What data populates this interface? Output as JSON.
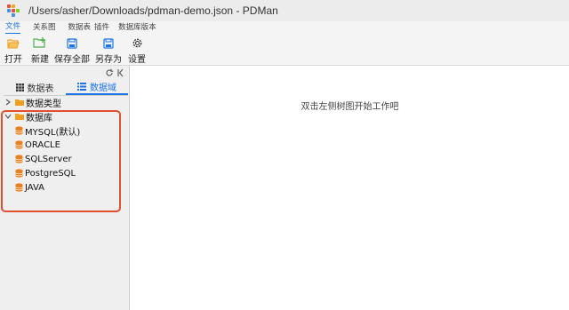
{
  "window": {
    "title": "/Users/asher/Downloads/pdman-demo.json - PDMan"
  },
  "menu": [
    "文件",
    "关系图",
    "数据表",
    "插件",
    "数据库版本"
  ],
  "toolbar": {
    "open": {
      "label": "打开",
      "icon": "folder-open-icon"
    },
    "new": {
      "label": "新建",
      "icon": "folder-plus-icon"
    },
    "save_all": {
      "label": "保存全部",
      "icon": "save-icon"
    },
    "save_as": {
      "label": "另存为",
      "icon": "save-as-icon"
    },
    "settings": {
      "label": "设置",
      "icon": "gear-icon"
    }
  },
  "sidebar": {
    "controls": {
      "refresh_icon": "refresh-icon",
      "collapse_icon": "collapse-icon"
    },
    "tabs": [
      {
        "label": "数据表",
        "active": false,
        "icon": "grid-icon"
      },
      {
        "label": "数据域",
        "active": true,
        "icon": "list-icon"
      }
    ],
    "tree": {
      "datatypes": {
        "label": "数据类型",
        "expanded": false
      },
      "databases": {
        "label": "数据库",
        "expanded": true,
        "items": [
          "MYSQL(默认)",
          "ORACLE",
          "SQLServer",
          "PostgreSQL",
          "JAVA"
        ]
      }
    }
  },
  "main": {
    "hint": "双击左侧树图开始工作吧"
  },
  "colors": {
    "accent": "#1a73e8",
    "folder": "#f0a020",
    "database": "#e8801c",
    "highlight": "#e0502e"
  }
}
